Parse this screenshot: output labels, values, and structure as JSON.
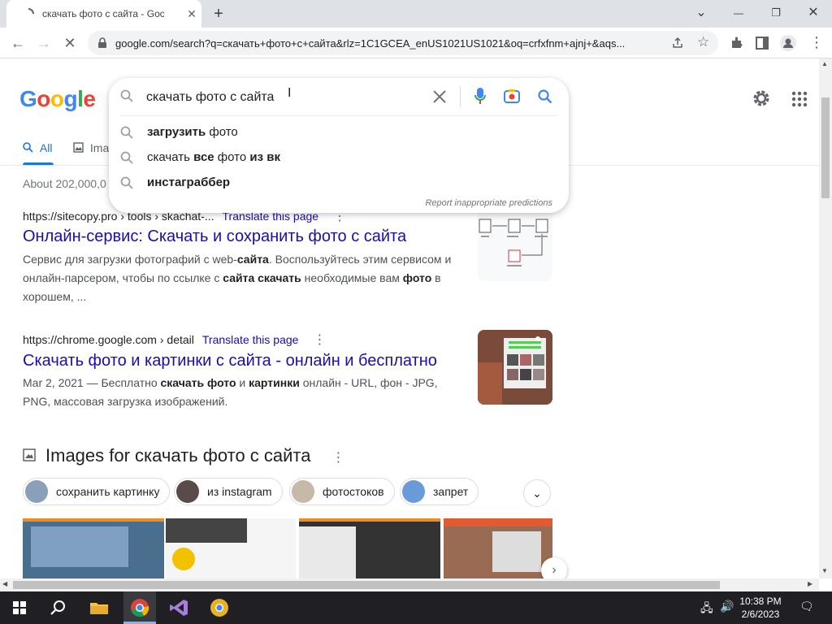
{
  "browser": {
    "tab_title": "скачать фото с сайта - Google S",
    "tab_close": "✕",
    "new_tab": "+",
    "url": "google.com/search?q=скачать+фото+с+сайта&rlz=1C1GCEA_enUS1021US1021&oq=crfxfnm+ajnj+&aqs...",
    "window_controls": {
      "tabsearch": "⌄",
      "minimize": "—",
      "restore": "❐",
      "close": "✕"
    }
  },
  "google": {
    "logo": [
      "G",
      "o",
      "o",
      "g",
      "l",
      "e"
    ],
    "logo_colors": [
      "#4285f4",
      "#ea4335",
      "#fbbc05",
      "#4285f4",
      "#34a853",
      "#ea4335"
    ],
    "search": {
      "value": "скачать фото с сайта",
      "suggestions": [
        {
          "bold": "загрузить",
          "rest": " фото"
        },
        {
          "pre": "скачать ",
          "bold": "все",
          "mid": " фото ",
          "bold2": "из вк"
        },
        {
          "bold": "инстаграббер"
        }
      ],
      "report": "Report inappropriate predictions"
    },
    "tabs": {
      "all": "All",
      "images": "Ima"
    },
    "result_stats": "About 202,000,0"
  },
  "results": [
    {
      "cite": "https://sitecopy.pro › tools › skachat-...",
      "translate": "Translate this page",
      "title": "Онлайн-сервис: Скачать и сохранить фото с сайта",
      "snippet_lines": [
        [
          "Сервис для загрузки фотографий с web-",
          "сайта",
          ". Воспользуйтесь этим сервисом и"
        ],
        [
          "онлайн-парсером, чтобы по ссылке с ",
          "сайта скачать",
          " необходимые вам ",
          "фото",
          " в"
        ],
        [
          "хорошем, ..."
        ]
      ]
    },
    {
      "cite": "https://chrome.google.com › detail",
      "translate": "Translate this page",
      "title": "Скачать фото и картинки с сайта - онлайн и бесплатно",
      "snippet_lines": [
        [
          "Mar 2, 2021 — Бесплатно ",
          "скачать фото",
          " и ",
          "картинки",
          " онлайн - URL, фон - JPG,"
        ],
        [
          "PNG, массовая загрузка изображений."
        ]
      ]
    }
  ],
  "images_section": {
    "heading": "Images for скачать фото с сайта",
    "chips": [
      "сохранить картинку",
      "из instagram",
      "фотостоков",
      "запрет"
    ]
  },
  "taskbar": {
    "time": "10:38 PM",
    "date": "2/6/2023"
  }
}
